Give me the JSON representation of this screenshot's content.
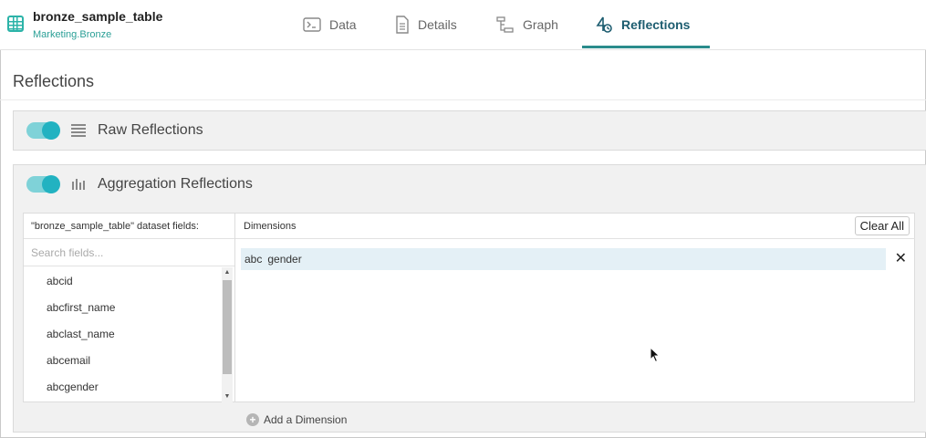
{
  "dataset": {
    "name": "bronze_sample_table",
    "path": "Marketing.Bronze"
  },
  "tabs": [
    {
      "label": "Data",
      "icon": "terminal-icon",
      "active": false
    },
    {
      "label": "Details",
      "icon": "document-icon",
      "active": false
    },
    {
      "label": "Graph",
      "icon": "graph-icon",
      "active": false
    },
    {
      "label": "Reflections",
      "icon": "reflections-icon",
      "active": true
    }
  ],
  "page_title": "Reflections",
  "raw": {
    "label": "Raw Reflections",
    "enabled": true
  },
  "aggregation": {
    "label": "Aggregation Reflections",
    "enabled": true,
    "fields_header": "\"bronze_sample_table\" dataset fields:",
    "search_placeholder": "Search fields...",
    "fields": [
      {
        "type": "abc",
        "name": "id"
      },
      {
        "type": "abc",
        "name": "first_name"
      },
      {
        "type": "abc",
        "name": "last_name"
      },
      {
        "type": "abc",
        "name": "email"
      },
      {
        "type": "abc",
        "name": "gender"
      }
    ],
    "dimensions_header": "Dimensions",
    "clear_all_label": "Clear All",
    "dimensions": [
      {
        "type": "abc",
        "name": "gender"
      }
    ],
    "add_dimension_label": "Add a Dimension"
  },
  "colors": {
    "accent": "#2bb3a8",
    "toggle_on": "#22b2c1",
    "active_tab": "#1d5d70",
    "selected_row": "#e4f0f6"
  }
}
